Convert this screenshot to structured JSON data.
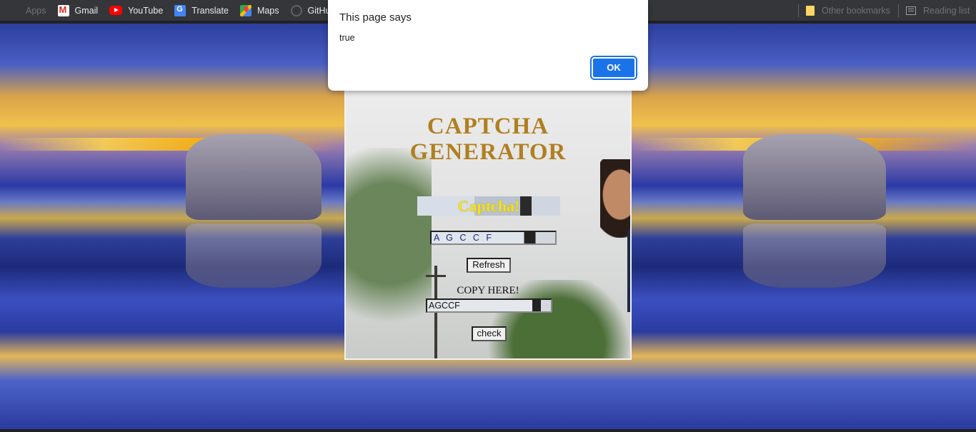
{
  "bookmarks": {
    "apps_label": "Apps",
    "items": [
      {
        "label": "Gmail",
        "icon": "gmail-icon"
      },
      {
        "label": "YouTube",
        "icon": "youtube-icon"
      },
      {
        "label": "Translate",
        "icon": "translate-icon"
      },
      {
        "label": "Maps",
        "icon": "maps-icon"
      },
      {
        "label": "GitHub",
        "icon": "github-icon"
      }
    ],
    "other_bookmarks": "Other bookmarks",
    "reading_list": "Reading list"
  },
  "dialog": {
    "title": "This page says",
    "message": "true",
    "ok_label": "OK"
  },
  "captcha": {
    "title_line1": "CAPTCHA",
    "title_line2": "GENERATOR",
    "banner": "Captcha!",
    "generated_code": "A G C C F",
    "refresh_label": "Refresh",
    "copy_label": "COPY HERE!",
    "copy_value": "AGCCF",
    "check_label": "check"
  },
  "colors": {
    "title": "#b07f21",
    "banner_text": "#f5e21b",
    "ok_button": "#1a73e8"
  }
}
